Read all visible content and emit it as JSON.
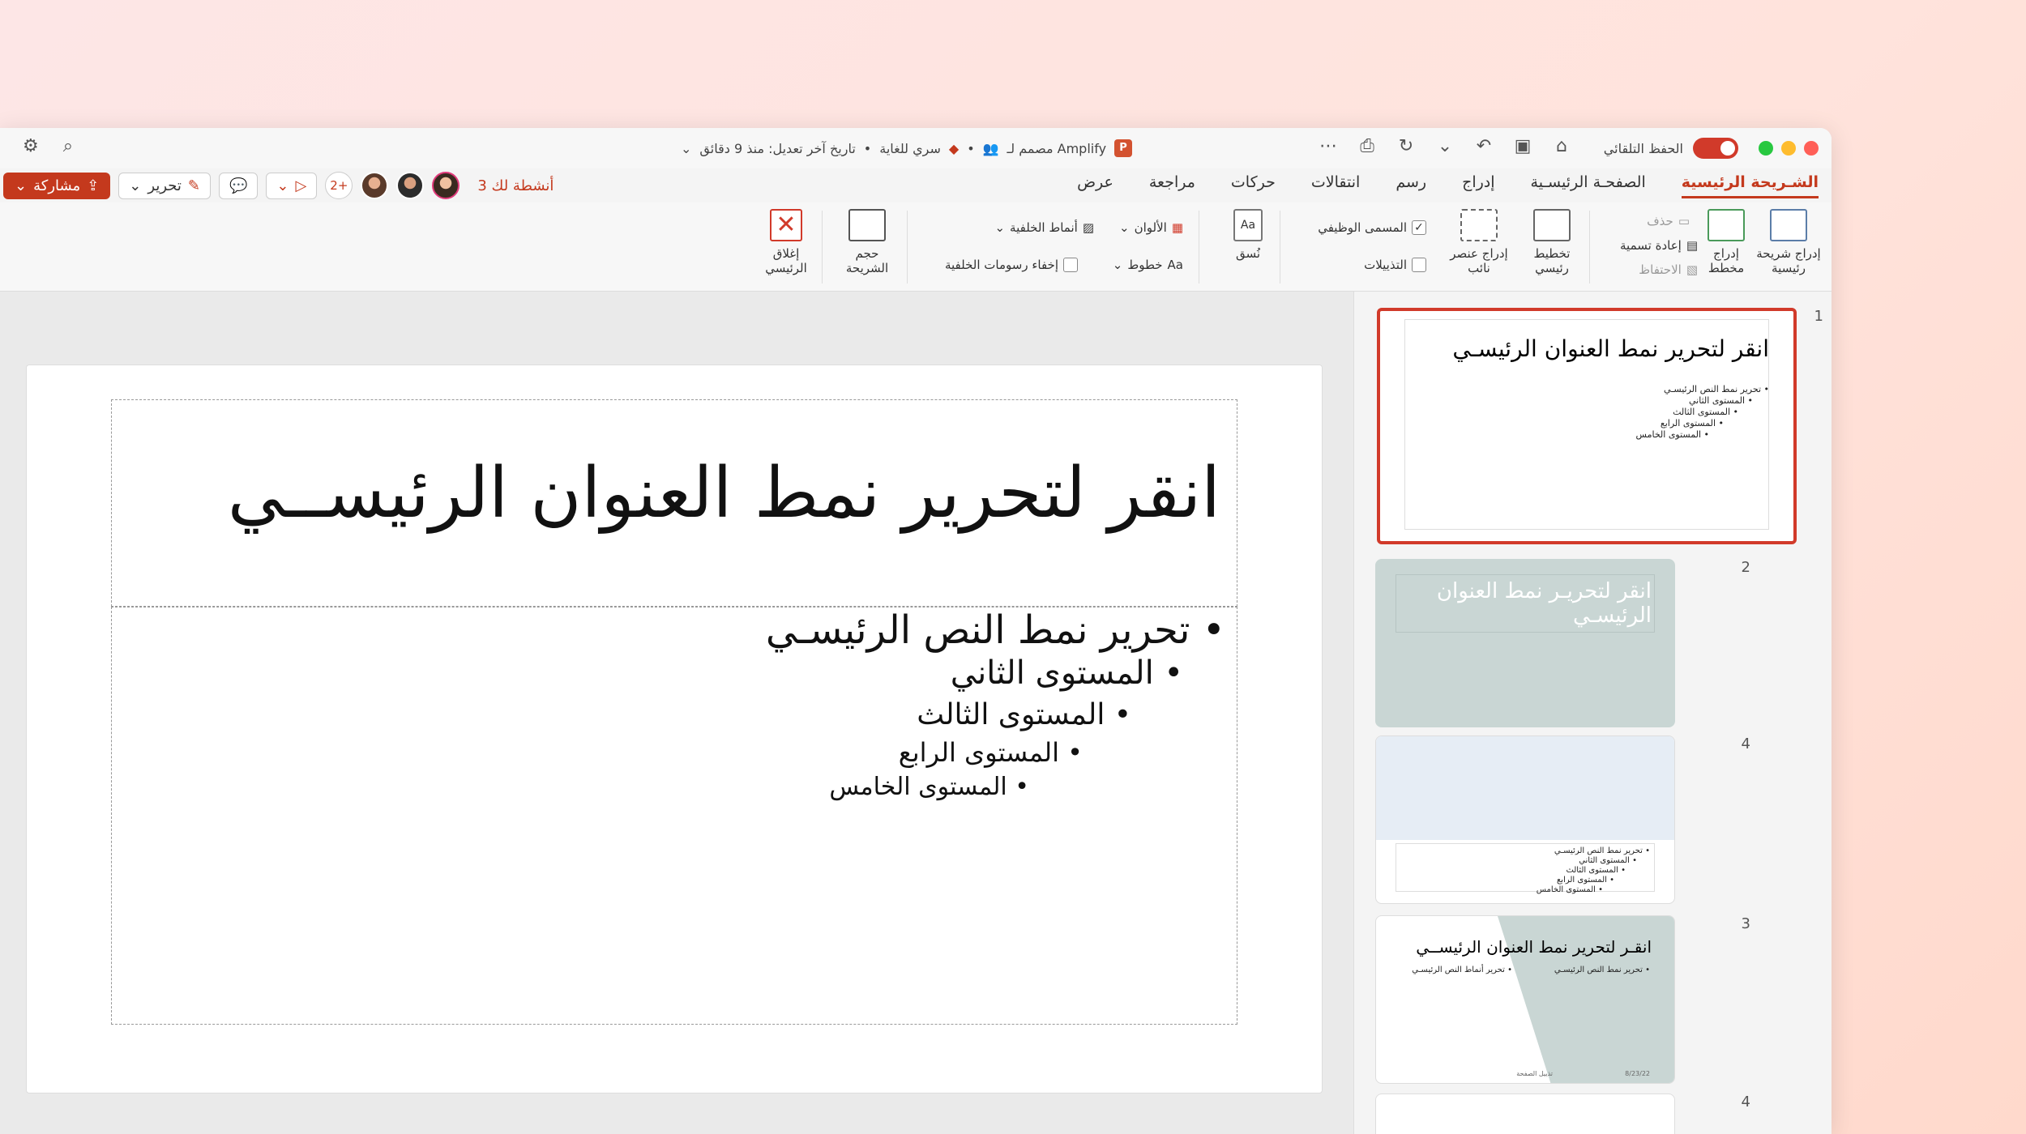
{
  "titlebar": {
    "autosave_label": "الحفظ التلقائي",
    "doc_name": "مصمم لـ Amplify",
    "sensitivity": "سري للغاية",
    "last_modified": "تاريخ آخر تعديل: منذ 9 دقائق",
    "app_badge": "P"
  },
  "tabs": [
    {
      "label": "الشـريحة الرئيسية",
      "active": true
    },
    {
      "label": "الصفحـة الرئيسـية"
    },
    {
      "label": "إدراج"
    },
    {
      "label": "رسم"
    },
    {
      "label": "انتقالات"
    },
    {
      "label": "حركات"
    },
    {
      "label": "مراجعة"
    },
    {
      "label": "عرض"
    }
  ],
  "actions": {
    "share_label": "مشاركة",
    "edit_label": "تحرير",
    "plus_count": "2+",
    "activities": "3 أنشطة لك"
  },
  "ribbon": {
    "insert_master": "إدراج شريحة رئيسية",
    "insert_layout": "إدراج مخطط",
    "delete": "حذف",
    "rename": "إعادة تسمية",
    "preserve": "الاحتفاظ",
    "master_layout": "تخطيط رئيسي",
    "insert_placeholder": "إدراج عنصر نائب",
    "title_check": "المسمى الوظيفي",
    "footers_check": "التذييلات",
    "themes": "نُسق",
    "colors": "الألوان",
    "fonts": "خطوط",
    "background_styles": "أنماط الخلفية",
    "hide_background": "إخفاء رسومات الخلفية",
    "slide_size": "حجم الشريحة",
    "close_master": "إغلاق الرئيسي"
  },
  "slide": {
    "title": "انقر لتحرير نمط العنوان الرئيســي",
    "levels": [
      "• تحرير نمط النص الرئيسـي",
      "• المستوى الثاني",
      "• المستوى الثالث",
      "• المستوى الرابع",
      "• المستوى الخامس"
    ]
  },
  "thumbnails": [
    {
      "num": "1",
      "title": "انقر لتحرير نمط العنوان الرئيسـي",
      "levels": [
        "• تحرير نمط النص الرئيسـي",
        "• المستوى الثاني",
        "• المستوى الثالث",
        "• المستوى الرابع",
        "• المستوى الخامس"
      ]
    },
    {
      "num": "2",
      "title": "انقر لتحريـر نمط العنوان الرئيسـي"
    },
    {
      "num": "4",
      "levels": [
        "• تحرير نمط النص الرئيسـي",
        "• المستوى الثاني",
        "• المستوى الثالث",
        "• المستوى الرابع",
        "• المستوى الخامس"
      ]
    },
    {
      "num": "3",
      "title": "انقـر لتحرير نمط العنوان الرئيســي",
      "col_a": "• تحرير أنماط النص الرئيسـي",
      "col_b": "• تحرير نمط النص الرئيسـي",
      "footer_left": "تذييل الصفحة",
      "footer_date": "8/23/22"
    },
    {
      "num": "4"
    }
  ],
  "colors": {
    "accent": "#c4391d",
    "thumb_teal": "#c9d6d4",
    "thumb_light": "#e6edf5"
  }
}
